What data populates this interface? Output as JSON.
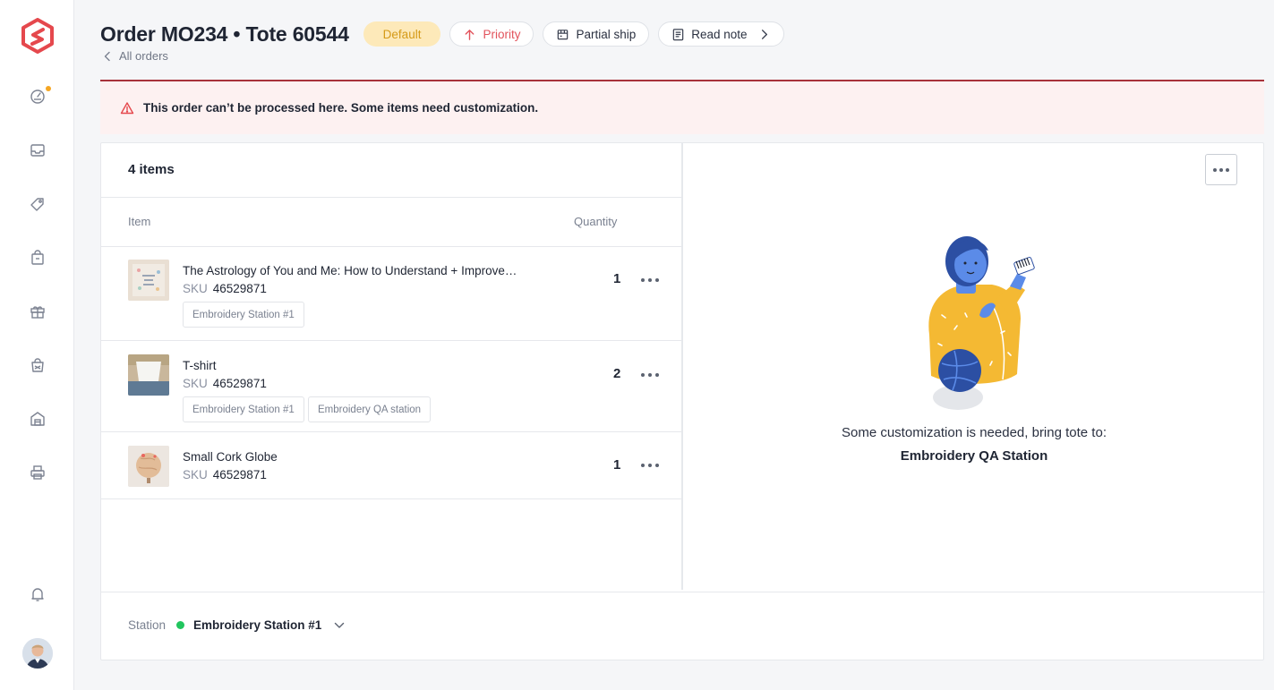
{
  "header": {
    "title": "Order MO234 • Tote 60544",
    "badges": {
      "default": "Default",
      "priority": "Priority",
      "partial_ship": "Partial ship",
      "read_note": "Read note"
    },
    "breadcrumb": "All orders"
  },
  "alert": {
    "message": "This order can’t be processed here. Some items need customization."
  },
  "items": {
    "count_label": "4 items",
    "columns": {
      "item": "Item",
      "quantity": "Quantity"
    },
    "rows": [
      {
        "name": "The Astrology of You and Me: How to Understand + Improve…",
        "sku_label": "SKU",
        "sku": "46529871",
        "quantity": "1",
        "tags": [
          "Embroidery Station #1"
        ]
      },
      {
        "name": "T-shirt",
        "sku_label": "SKU",
        "sku": "46529871",
        "quantity": "2",
        "tags": [
          "Embroidery Station #1",
          "Embroidery QA station"
        ]
      },
      {
        "name": "Small Cork Globe",
        "sku_label": "SKU",
        "sku": "46529871",
        "quantity": "1",
        "tags": []
      }
    ]
  },
  "customization": {
    "message": "Some customization is needed, bring tote to:",
    "station": "Embroidery QA Station"
  },
  "footer": {
    "station_label": "Station",
    "station_value": "Embroidery Station #1",
    "status_color": "#22c55e"
  },
  "colors": {
    "brand": "#e5484d",
    "alert_border": "#a8323a",
    "alert_bg": "#fdf1f1",
    "default_badge_bg": "#fde9b9",
    "default_badge_text": "#d59a18",
    "notification_dot": "#f5a623"
  },
  "sidebar": {
    "icons": [
      "dashboard-icon",
      "inbox-icon",
      "tag-icon",
      "bag-icon",
      "gift-icon",
      "shop-bag-icon",
      "warehouse-icon",
      "printer-icon",
      "bell-icon"
    ]
  }
}
